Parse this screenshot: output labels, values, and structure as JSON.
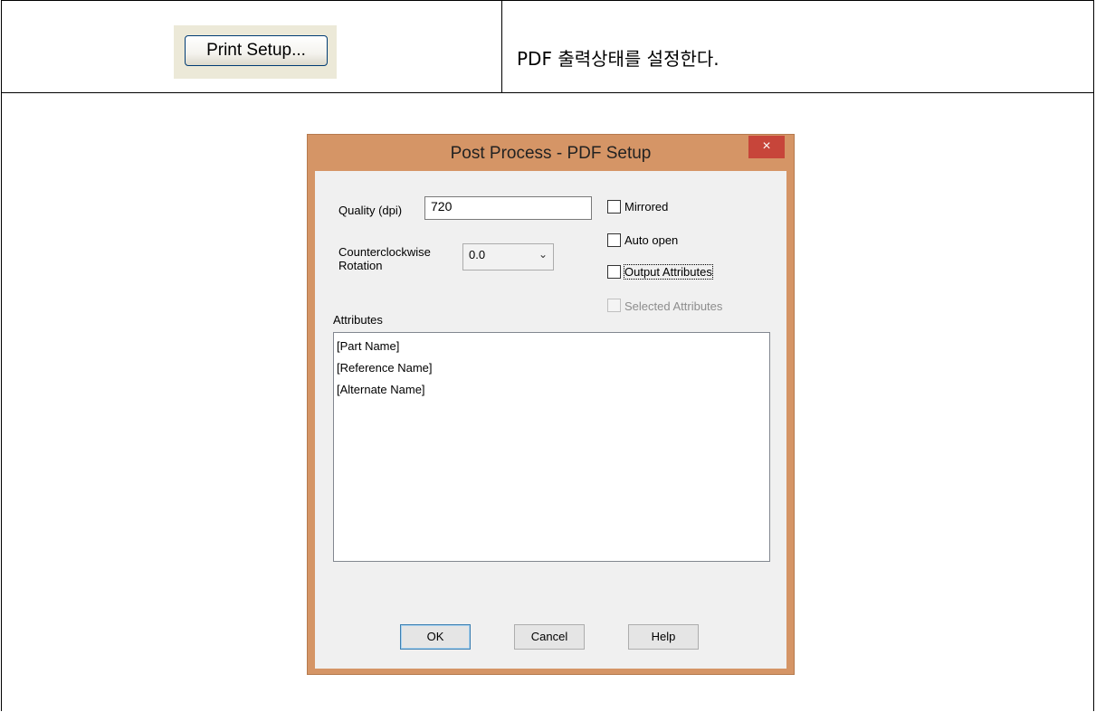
{
  "sample": {
    "print_setup_label": "Print Setup..."
  },
  "description": "PDF 출력상태를 설정한다.",
  "dialog": {
    "title": "Post Process - PDF Setup",
    "close_symbol": "×",
    "quality_label": "Quality (dpi)",
    "quality_value": "720",
    "rotation_label_line1": "Counterclockwise",
    "rotation_label_line2": "Rotation",
    "rotation_value": "0.0",
    "mirrored_label": "Mirrored",
    "auto_open_label": "Auto open",
    "output_attributes_label": "Output Attributes",
    "selected_attributes_label": "Selected Attributes",
    "attributes_label": "Attributes",
    "attributes_items": [
      "[Part Name]",
      "[Reference Name]",
      "[Alternate Name]"
    ],
    "ok_label": "OK",
    "cancel_label": "Cancel",
    "help_label": "Help"
  },
  "colors": {
    "dialog_frame": "#d59566",
    "close_button": "#c7453a",
    "client_bg": "#f0f0f0"
  }
}
